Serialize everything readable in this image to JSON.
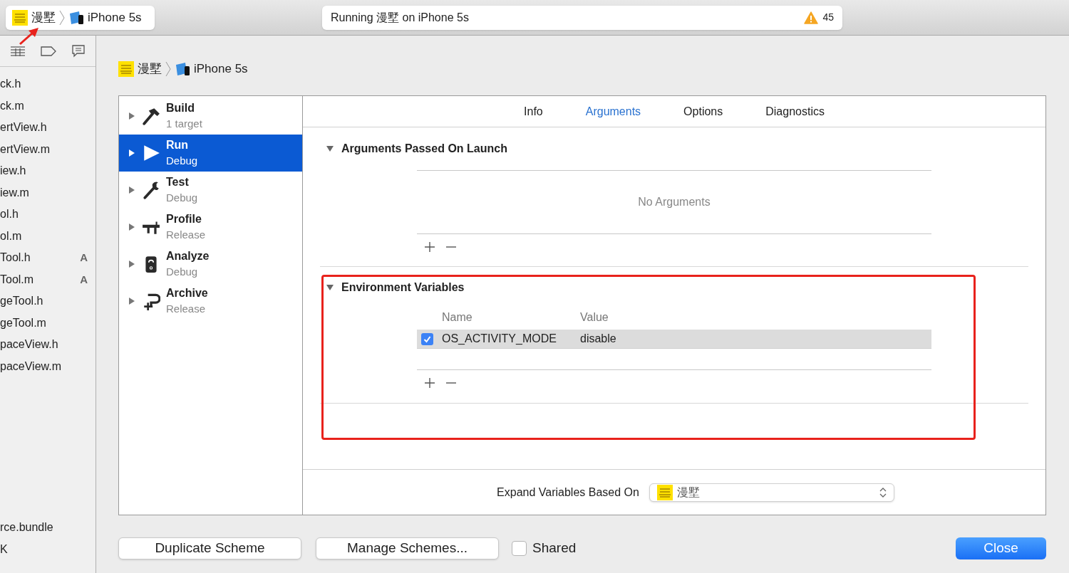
{
  "toolbar": {
    "scheme": {
      "app": "漫墅",
      "device": "iPhone 5s"
    },
    "status": {
      "text": "Running 漫墅 on iPhone 5s",
      "warnings": "45"
    }
  },
  "navigator": {
    "files": [
      {
        "name": "ck.h"
      },
      {
        "name": "ck.m"
      },
      {
        "name": "ertView.h"
      },
      {
        "name": "ertView.m"
      },
      {
        "name": "iew.h"
      },
      {
        "name": "iew.m"
      },
      {
        "name": "ol.h"
      },
      {
        "name": "ol.m"
      },
      {
        "name": "Tool.h",
        "badge": "A"
      },
      {
        "name": "Tool.m",
        "badge": "A"
      },
      {
        "name": "geTool.h"
      },
      {
        "name": "geTool.m"
      },
      {
        "name": "paceView.h"
      },
      {
        "name": "paceView.m"
      }
    ],
    "files_bottom": [
      {
        "name": "rce.bundle"
      },
      {
        "name": "K"
      }
    ]
  },
  "sheet": {
    "breadcrumb": {
      "app": "漫墅",
      "device": "iPhone 5s"
    },
    "actions": [
      {
        "kind": "build",
        "name": "Build",
        "subtitle": "1 target",
        "selected": false,
        "expanded": false
      },
      {
        "kind": "run",
        "name": "Run",
        "subtitle": "Debug",
        "selected": true,
        "expanded": false
      },
      {
        "kind": "test",
        "name": "Test",
        "subtitle": "Debug",
        "selected": false,
        "expanded": false
      },
      {
        "kind": "profile",
        "name": "Profile",
        "subtitle": "Release",
        "selected": false,
        "expanded": false
      },
      {
        "kind": "analyze",
        "name": "Analyze",
        "subtitle": "Debug",
        "selected": false,
        "expanded": false
      },
      {
        "kind": "archive",
        "name": "Archive",
        "subtitle": "Release",
        "selected": false,
        "expanded": false
      }
    ],
    "tabs": [
      {
        "label": "Info",
        "selected": false
      },
      {
        "label": "Arguments",
        "selected": true
      },
      {
        "label": "Options",
        "selected": false
      },
      {
        "label": "Diagnostics",
        "selected": false
      }
    ],
    "arguments": {
      "title": "Arguments Passed On Launch",
      "expanded": true,
      "empty_text": "No Arguments"
    },
    "environment": {
      "title": "Environment Variables",
      "expanded": true,
      "columns": [
        "Name",
        "Value"
      ],
      "rows": [
        {
          "name": "OS_ACTIVITY_MODE",
          "value": "disable",
          "checked": true,
          "selected": true
        }
      ]
    },
    "expand_variables": {
      "label": "Expand Variables Based On",
      "value": "漫墅"
    },
    "buttons": {
      "duplicate": "Duplicate Scheme",
      "manage": "Manage Schemes...",
      "shared": {
        "label": "Shared",
        "checked": false
      },
      "close": "Close"
    }
  }
}
